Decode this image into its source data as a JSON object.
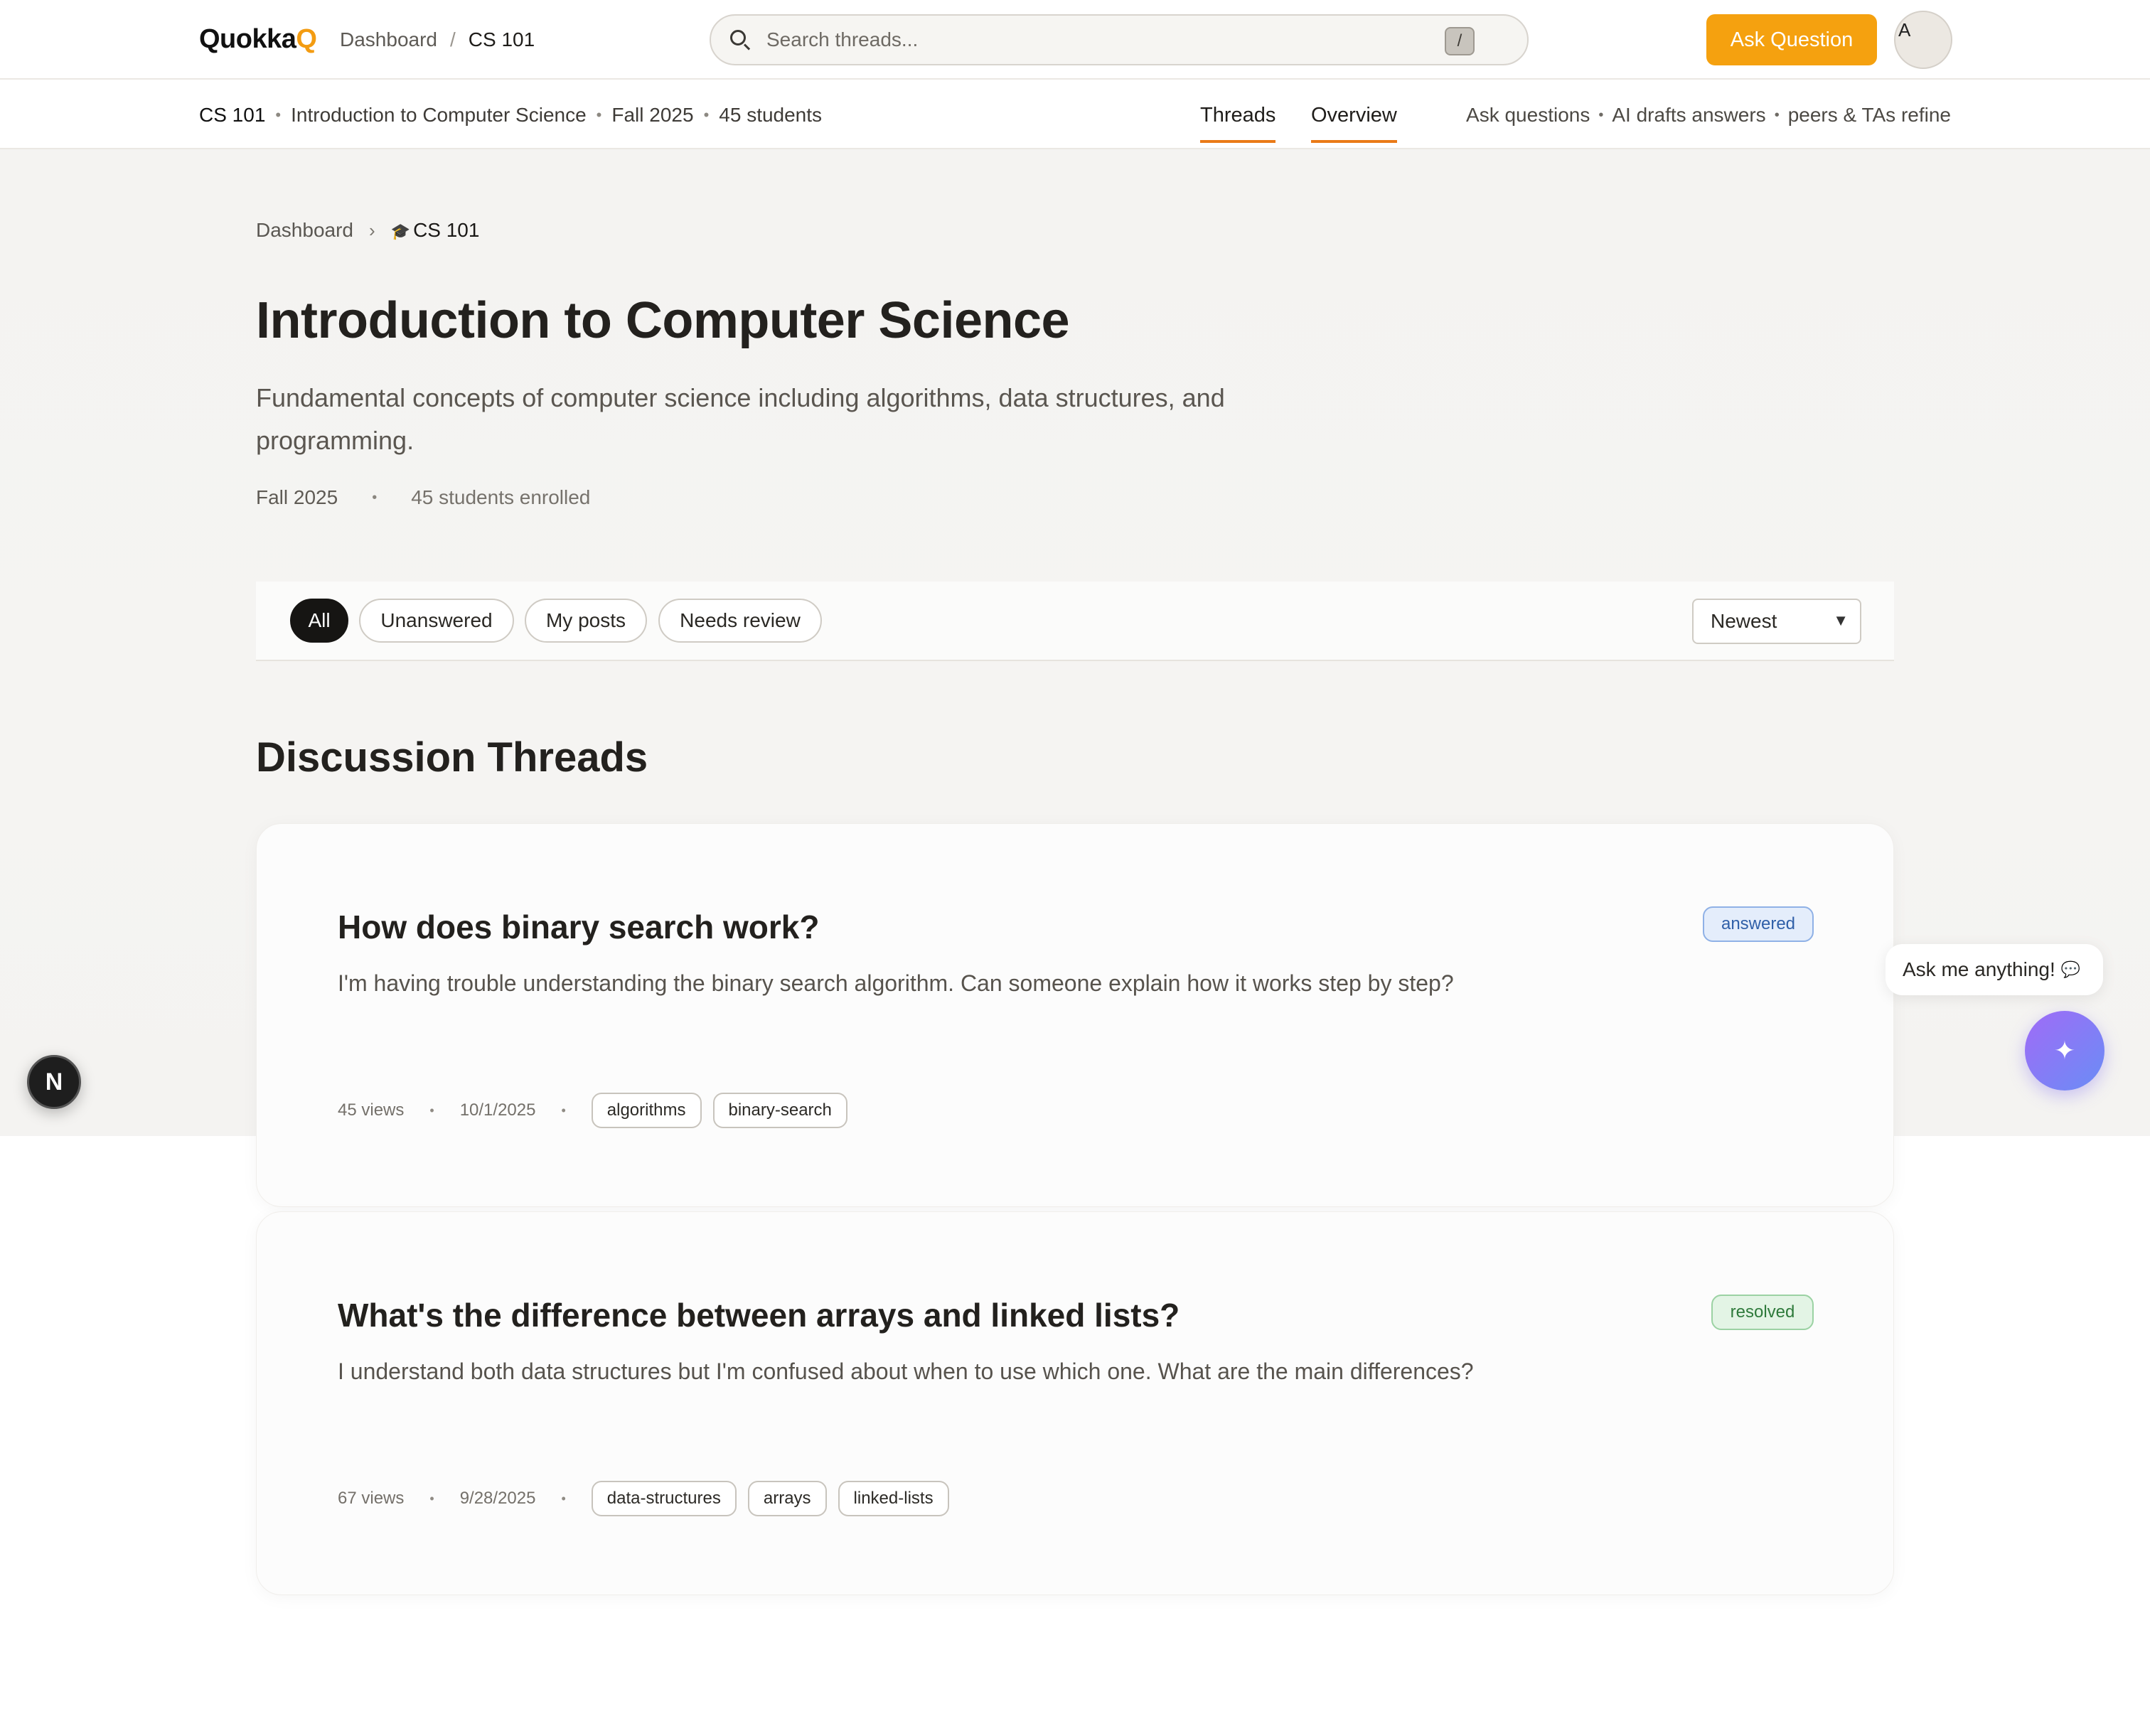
{
  "app": {
    "logo_main": "Quokka",
    "logo_accent": "Q"
  },
  "top_breadcrumb": {
    "dashboard": "Dashboard",
    "separator": "/",
    "current": "CS 101"
  },
  "search": {
    "placeholder": "Search threads...",
    "shortcut": "/"
  },
  "header": {
    "ask_button": "Ask Question",
    "avatar_initial": "A"
  },
  "subbar": {
    "code": "CS 101",
    "name": "Introduction to Computer Science",
    "term": "Fall 2025",
    "students": "45 students",
    "tabs": [
      {
        "label": "Threads"
      },
      {
        "label": "Overview"
      }
    ],
    "tagline": [
      "Ask questions",
      "AI drafts answers",
      "peers & TAs refine"
    ]
  },
  "breadcrumb": {
    "dashboard": "Dashboard",
    "current": "CS 101"
  },
  "course": {
    "title": "Introduction to Computer Science",
    "description": "Fundamental concepts of computer science including algorithms, data structures, and programming.",
    "term": "Fall 2025",
    "enrolled": "45 students enrolled"
  },
  "filters": {
    "chips": [
      "All",
      "Unanswered",
      "My posts",
      "Needs review"
    ],
    "active": "All",
    "sort": "Newest"
  },
  "section_title": "Discussion Threads",
  "threads": [
    {
      "title": "How does binary search work?",
      "body": "I'm having trouble understanding the binary search algorithm. Can someone explain how it works step by step?",
      "status": "answered",
      "views": "45 views",
      "date": "10/1/2025",
      "tags": [
        "algorithms",
        "binary-search"
      ]
    },
    {
      "title": "What's the difference between arrays and linked lists?",
      "body": "I understand both data structures but I'm confused about when to use which one. What are the main differences?",
      "status": "resolved",
      "views": "67 views",
      "date": "9/28/2025",
      "tags": [
        "data-structures",
        "arrays",
        "linked-lists"
      ]
    }
  ],
  "floating": {
    "ai_prompt": "Ask me anything!",
    "next_badge": "N"
  },
  "colors": {
    "accent": "#f5a10f",
    "tab_underline": "#ea7a17",
    "active_chip": "#161513"
  }
}
